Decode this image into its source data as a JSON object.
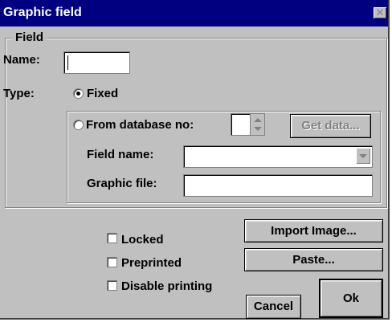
{
  "window": {
    "title": "Graphic field",
    "close_glyph": "✕"
  },
  "group": {
    "legend": "Field"
  },
  "name": {
    "label": "Name:",
    "value": ""
  },
  "type": {
    "label": "Type:",
    "fixed_label": "Fixed",
    "db_label": "From database no:",
    "selected": "fixed"
  },
  "db": {
    "number": "",
    "get_data_label": "Get data..."
  },
  "field_name": {
    "label": "Field name:",
    "value": ""
  },
  "graphic_file": {
    "label": "Graphic file:",
    "value": ""
  },
  "checkboxes": {
    "locked": "Locked",
    "preprinted": "Preprinted",
    "disable_printing": "Disable printing"
  },
  "buttons": {
    "import_image": "Import Image...",
    "paste": "Paste...",
    "cancel": "Cancel",
    "ok": "Ok"
  }
}
